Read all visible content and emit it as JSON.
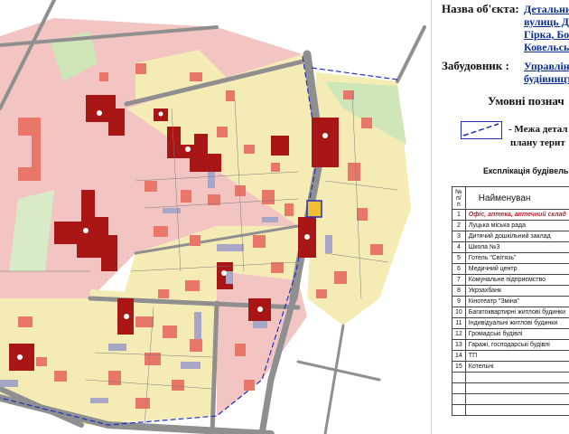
{
  "header": {
    "object_label": "Назва об'єкта:",
    "object_lines": [
      "Детальни",
      "вулиць Да",
      "Гірка, Бо",
      "Ковельсь"
    ],
    "developer_label": "Забудовник :",
    "developer_lines": [
      "Управлінн",
      "будівництв"
    ]
  },
  "legend": {
    "title": "Умовні познач",
    "item_line1": "-  Межа детал",
    "item_line2": "плану терит",
    "line_color": "#1b2fb0"
  },
  "table": {
    "title": "Експлікація будівель т",
    "header_num": "№ п/п",
    "header_name": "Найменуван",
    "rows": [
      {
        "num": "1",
        "name": "Офіс, аптека, аптечний склад"
      },
      {
        "num": "2",
        "name": "Луцька міська рада"
      },
      {
        "num": "3",
        "name": "Дитячий дошкільний заклад"
      },
      {
        "num": "4",
        "name": "Школа №3"
      },
      {
        "num": "5",
        "name": "Готель \"Світязь\""
      },
      {
        "num": "6",
        "name": "Медичний центр"
      },
      {
        "num": "7",
        "name": "Комунальне підприємство"
      },
      {
        "num": "8",
        "name": "Укрзахбанк"
      },
      {
        "num": "9",
        "name": "Кінотеатр \"Зміна\""
      },
      {
        "num": "10",
        "name": "Багатоквартирні житлові будинки"
      },
      {
        "num": "11",
        "name": "Індивідуальні житлові будинки"
      },
      {
        "num": "12",
        "name": "Громадські будівлі"
      },
      {
        "num": "13",
        "name": "Гаражі, господарські будівлі"
      },
      {
        "num": "14",
        "name": "ТП"
      },
      {
        "num": "15",
        "name": "Котельні"
      },
      {
        "num": "",
        "name": ""
      },
      {
        "num": "",
        "name": ""
      },
      {
        "num": "",
        "name": ""
      },
      {
        "num": "",
        "name": ""
      }
    ]
  },
  "map": {
    "colors": {
      "background": "#ffffff",
      "public_zone": "#f2c5c3",
      "residential_zone": "#f5ecb5",
      "green": "#cfe6b8",
      "road": "#8f8f8f",
      "public_building": "#a81616",
      "residential_building": "#e8776a",
      "garage": "#a8a6c6",
      "boundary": "#2030c0"
    }
  }
}
